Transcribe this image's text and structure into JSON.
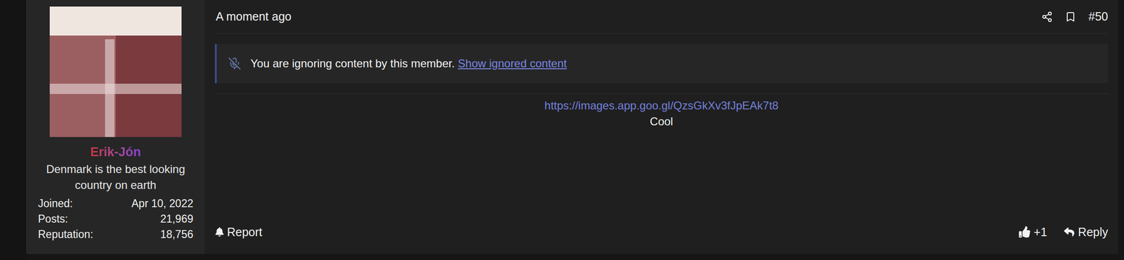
{
  "post": {
    "time": "A moment ago",
    "number": "#50"
  },
  "user": {
    "name": "Erik-Jón",
    "title": "Denmark is the best looking country on earth",
    "stats": [
      {
        "label": "Joined:",
        "value": "Apr 10, 2022"
      },
      {
        "label": "Posts:",
        "value": "21,969"
      },
      {
        "label": "Reputation:",
        "value": "18,756"
      }
    ]
  },
  "notice": {
    "text": "You are ignoring content by this member.",
    "link": "Show ignored content"
  },
  "content": {
    "link": "https://images.app.goo.gl/QzsGkXv3fJpEAk7t8",
    "text": "Cool"
  },
  "footer": {
    "report": "Report",
    "likes": "+1",
    "reply": "Reply"
  }
}
